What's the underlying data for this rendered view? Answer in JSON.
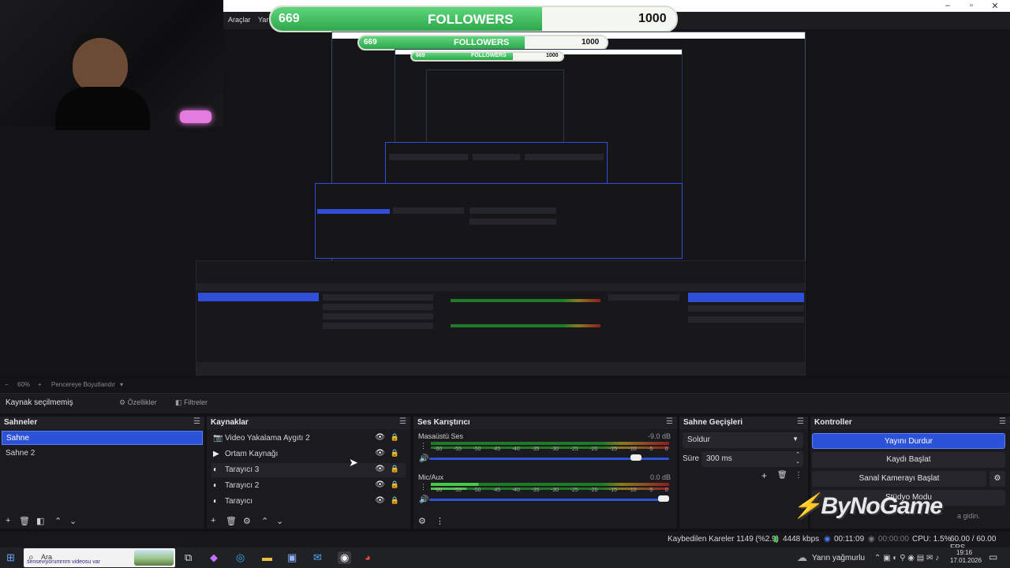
{
  "colors": {
    "accent": "#2b52d8",
    "follow_fill": "#2ea74b",
    "bg": "#1b1b1f"
  },
  "follower_goal": {
    "current": "669",
    "label": "FOLLOWERS",
    "target": "1000",
    "fill_fraction": 0.669
  },
  "obs_menu": {
    "items": [
      "Araçlar",
      "Yar"
    ]
  },
  "preview_controls": {
    "zoom_minus": "−",
    "zoom": "60%",
    "zoom_plus": "+",
    "resize_label": "Pencereye Boyutlandır"
  },
  "context_bar": {
    "source_status": "Kaynak seçilmemiş",
    "properties": "Özellikler",
    "filters": "Filtreler"
  },
  "scenes": {
    "title": "Sahneler",
    "items": [
      {
        "label": "Sahne",
        "selected": true
      },
      {
        "label": "Sahne 2",
        "selected": false
      }
    ]
  },
  "sources": {
    "title": "Kaynaklar",
    "items": [
      {
        "label": "Video Yakalama Aygıtı 2",
        "icon": "camera-icon"
      },
      {
        "label": "Ortam Kaynağı",
        "icon": "play-icon"
      },
      {
        "label": "Tarayıcı 3",
        "icon": "browser-icon"
      },
      {
        "label": "Tarayıcı 2",
        "icon": "browser-icon"
      },
      {
        "label": "Tarayıcı",
        "icon": "browser-icon"
      }
    ]
  },
  "mixer": {
    "title": "Ses Karıştırıcı",
    "channels": [
      {
        "name": "Masaüstü Ses",
        "db": "-9.0 dB",
        "volume": 0.88
      },
      {
        "name": "Mic/Aux",
        "db": "0.0 dB",
        "volume": 1.0
      }
    ],
    "scale": [
      "-60",
      "-55",
      "-50",
      "-45",
      "-40",
      "-35",
      "-30",
      "-25",
      "-20",
      "-15",
      "-10",
      "-5",
      "0"
    ]
  },
  "transitions": {
    "title": "Sahne Geçişleri",
    "selected": "Soldur",
    "duration_label": "Süre",
    "duration_value": "300 ms"
  },
  "controls": {
    "title": "Kontroller",
    "stop_stream": "Yayını Durdur",
    "start_recording": "Kaydı Başlat",
    "start_virtualcam": "Sanal Kamerayı Başlat",
    "studio_mode": "Stüdyo Modu",
    "activate_hint": "a gidin."
  },
  "status": {
    "dropped_frames": "Kaybedilen Kareler 1149 (%2.9)",
    "bitrate": "4448 kbps",
    "stream_time": "00:11:09",
    "rec_time": "00:00:00",
    "cpu": "CPU: 1.5%",
    "fps": "60.00 / 60.00 FPS"
  },
  "taskbar": {
    "search_placeholder": "Ara",
    "search_overlay": "senseviyorumrnm videosu var",
    "weather": "Yarın yağmurlu",
    "time": "19:16",
    "date": "17.01.2026"
  },
  "watermark": {
    "text": "ByNoGame"
  }
}
